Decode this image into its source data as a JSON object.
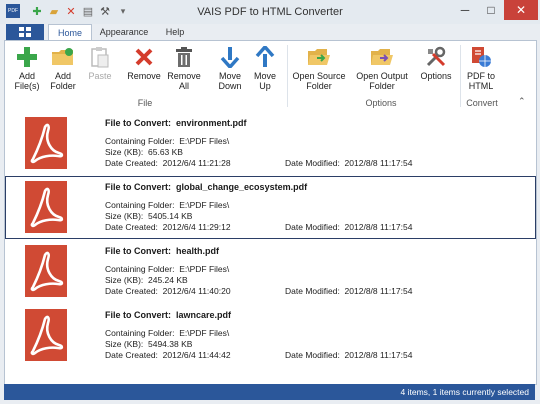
{
  "window": {
    "title": "VAIS PDF to HTML Converter",
    "minimize_glyph": "─",
    "maximize_glyph": "□",
    "close_glyph": "✕"
  },
  "quick_access": [
    {
      "name": "app-logo-icon",
      "glyph": "PDF"
    },
    {
      "name": "add-icon",
      "glyph": "✚"
    },
    {
      "name": "folder-icon",
      "glyph": "▰"
    },
    {
      "name": "remove-icon",
      "glyph": "✕"
    },
    {
      "name": "trash-icon",
      "glyph": "▤"
    },
    {
      "name": "wrench-icon",
      "glyph": "⚒"
    },
    {
      "name": "customize-dropdown-icon",
      "glyph": "▾"
    }
  ],
  "tabs": [
    {
      "label": "Home",
      "active": true
    },
    {
      "label": "Appearance",
      "active": false
    },
    {
      "label": "Help",
      "active": false
    }
  ],
  "ribbon": {
    "buttons": [
      {
        "label": "Add\nFile(s)",
        "icon": "plus-icon",
        "disabled": false
      },
      {
        "label": "Add\nFolder",
        "icon": "add-folder-icon",
        "disabled": false
      },
      {
        "label": "Paste",
        "icon": "paste-icon",
        "disabled": true
      },
      {
        "label": "Remove",
        "icon": "remove-icon",
        "disabled": false
      },
      {
        "label": "Remove\nAll",
        "icon": "trash-icon",
        "disabled": false
      },
      {
        "label": "Move\nDown",
        "icon": "arrow-down-icon",
        "disabled": false
      },
      {
        "label": "Move\nUp",
        "icon": "arrow-up-icon",
        "disabled": false
      },
      {
        "label": "Open Source\nFolder",
        "icon": "open-source-folder-icon",
        "disabled": false
      },
      {
        "label": "Open Output\nFolder",
        "icon": "open-output-folder-icon",
        "disabled": false
      },
      {
        "label": "Options",
        "icon": "tools-icon",
        "disabled": false
      },
      {
        "label": "PDF to\nHTML",
        "icon": "pdf-to-html-icon",
        "disabled": false
      }
    ],
    "groups": [
      "File",
      "Options",
      "Convert"
    ],
    "collapse_glyph": "⌃"
  },
  "labels": {
    "file_to_convert": "File to Convert:",
    "containing_folder": "Containing Folder:",
    "size_kb": "Size (KB):",
    "date_created": "Date Created:",
    "date_modified": "Date Modified:"
  },
  "files": [
    {
      "name": "environment.pdf",
      "folder": "E:\\PDF Files\\",
      "size": "65.63 KB",
      "created": "2012/6/4 11:21:28",
      "modified": "2012/8/8 11:17:54",
      "selected": false
    },
    {
      "name": "global_change_ecosystem.pdf",
      "folder": "E:\\PDF Files\\",
      "size": "5405.14 KB",
      "created": "2012/6/4 11:29:12",
      "modified": "2012/8/8 11:17:54",
      "selected": true
    },
    {
      "name": "health.pdf",
      "folder": "E:\\PDF Files\\",
      "size": "245.24 KB",
      "created": "2012/6/4 11:40:20",
      "modified": "2012/8/8 11:17:54",
      "selected": false
    },
    {
      "name": "lawncare.pdf",
      "folder": "E:\\PDF Files\\",
      "size": "5494.38 KB",
      "created": "2012/6/4 11:44:42",
      "modified": "2012/8/8 11:17:54",
      "selected": false
    }
  ],
  "status": "4 items, 1 items currently selected",
  "colors": {
    "accent": "#2b579a",
    "pdf_red": "#d04a34"
  }
}
